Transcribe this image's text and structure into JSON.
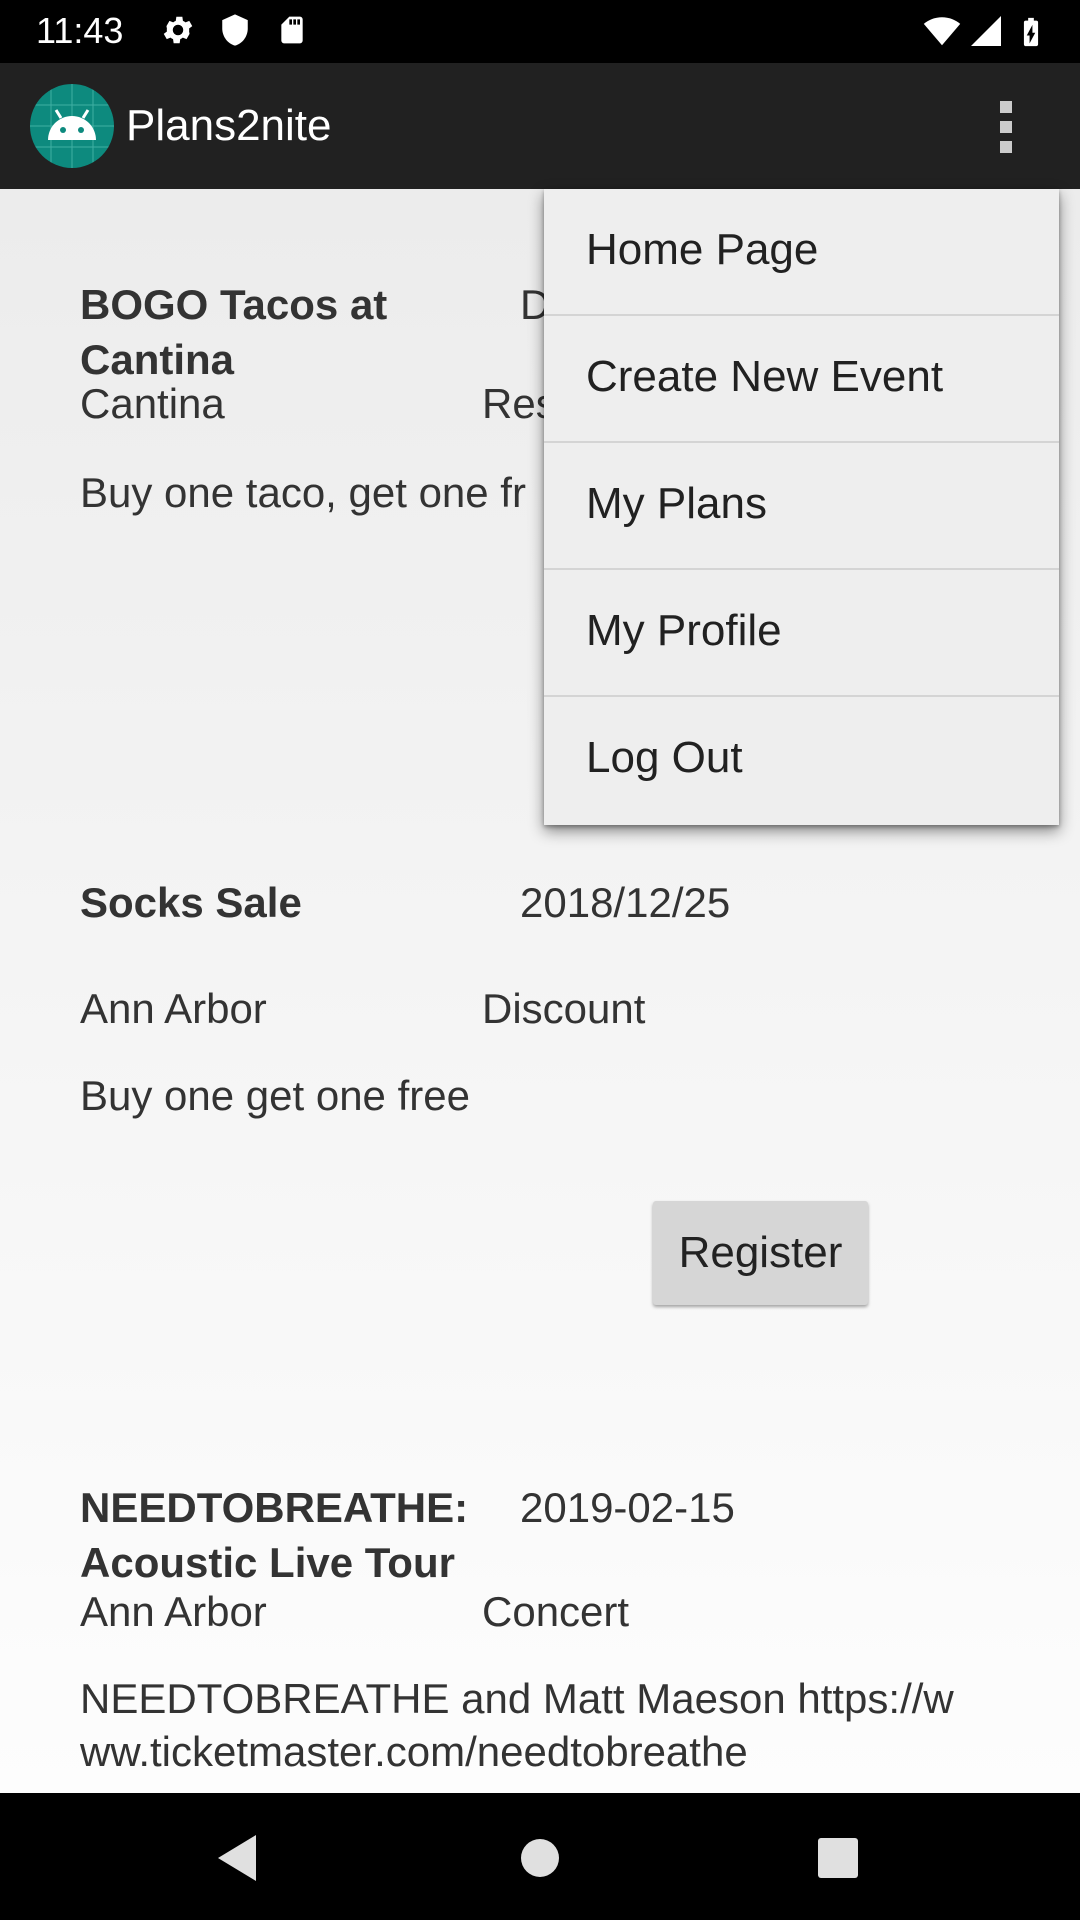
{
  "status_bar": {
    "time": "11:43",
    "left_icons": [
      "settings-icon",
      "shield-icon",
      "sd-card-icon"
    ],
    "right_icons": [
      "wifi-icon",
      "cell-signal-icon",
      "battery-charging-icon"
    ]
  },
  "app_bar": {
    "title": "Plans2nite",
    "logo_icon": "android-icon",
    "overflow_icon": "more-vert-icon"
  },
  "events": [
    {
      "title": "BOGO Tacos at Cantina",
      "date": "D",
      "location": "Cantina",
      "type": "Res",
      "description": "Buy one taco, get one fr"
    },
    {
      "title": "Socks Sale",
      "date": "2018/12/25",
      "location": "Ann Arbor",
      "type": "Discount",
      "description": "Buy one get one free",
      "button_label": "Register"
    },
    {
      "title": "NEEDTOBREATHE: Acoustic Live Tour",
      "date": "2019-02-15",
      "location": "Ann Arbor",
      "type": "Concert",
      "description": "NEEDTOBREATHE and Matt Maeson https://www.ticketmaster.com/needtobreathe"
    }
  ],
  "menu": {
    "items": [
      {
        "label": "Home Page"
      },
      {
        "label": "Create New Event"
      },
      {
        "label": "My Plans"
      },
      {
        "label": "My Profile"
      },
      {
        "label": "Log Out"
      }
    ]
  },
  "nav_bar": {
    "icons": [
      "back-icon",
      "home-icon",
      "recents-icon"
    ]
  },
  "colors": {
    "status_bar": "#000000",
    "app_bar": "#212121",
    "menu_bg": "#eeeeee",
    "button_bg": "#d6d6d6",
    "logo_bg": "#0d8a7e"
  }
}
